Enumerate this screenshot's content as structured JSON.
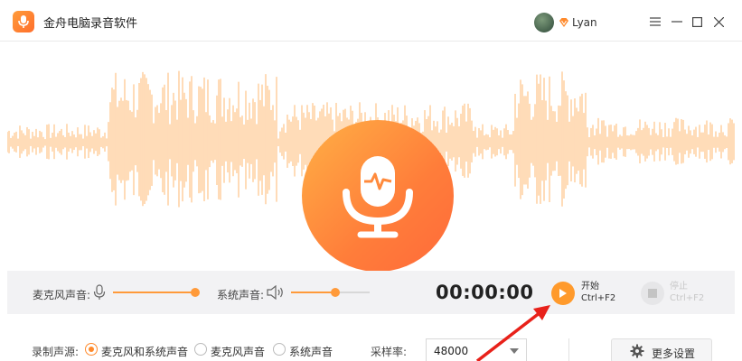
{
  "app": {
    "title": "金舟电脑录音软件"
  },
  "user": {
    "name": "Lyan"
  },
  "colors": {
    "accent": "#ff9a2c",
    "wave": "#ffcc99"
  },
  "controls": {
    "mic_label": "麦克风声音:",
    "mic_volume_percent": 100,
    "system_label": "系统声音:",
    "system_volume_percent": 56,
    "timer": "00:00:00",
    "start_label": "开始",
    "start_shortcut": "Ctrl+F2",
    "stop_label": "停止",
    "stop_shortcut": "Ctrl+F2"
  },
  "settings": {
    "source_label": "录制声源:",
    "sources": [
      "麦克风和系统声音",
      "麦克风声音",
      "系统声音"
    ],
    "selected_source": 0,
    "sample_rate_label": "采样率:",
    "sample_rate_value": "48000",
    "more_settings_label": "更多设置"
  }
}
